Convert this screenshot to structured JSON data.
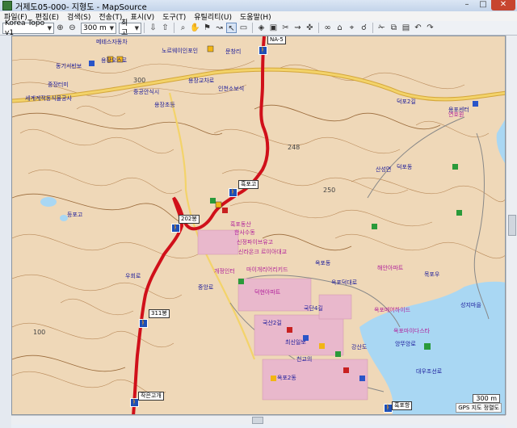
{
  "window": {
    "title": "거제도05-000- 지형도 - MapSource",
    "min": "–",
    "max": "□",
    "close": "✕"
  },
  "menu": [
    "파일(F)",
    "편집(E)",
    "검색(S)",
    "전송(T)",
    "표시(V)",
    "도구(T)",
    "유틸리티(U)",
    "도움말(H)"
  ],
  "toolbar": {
    "map_product": "Korea Topo v1",
    "zoom_level": "300 m",
    "detail": "최고"
  },
  "map": {
    "waypoints": [
      "NA-5",
      "흑포고",
      "202봉",
      "311봉",
      "작은고개",
      "흑포항"
    ],
    "contour_labels": [
      "250",
      "248",
      "100",
      "300"
    ],
    "labels": [
      "메테스자동차",
      "동기서반보",
      "노르웨이인포인",
      "용장오스로",
      "중장터미",
      "세계계적동식물공사",
      "중공안식시",
      "용장교차로",
      "용장초등",
      "문창리",
      "인천소보석",
      "용포센터",
      "덕포2길",
      "덕포동",
      "산성면",
      "등포고",
      "흑포동산",
      "한사수동",
      "신정파이브유고",
      "신라온크 르이아대교",
      "마이개리어리키드",
      "해안아파트",
      "옥포메어하이드",
      "덕현아파트",
      "연호원",
      "옥포마이다스타",
      "성지마을",
      "개정인터",
      "우회로",
      "목포우",
      "옥포동",
      "국산2길",
      "국단4길",
      "옥포덕대로",
      "중앙로",
      "강산도",
      "최신일보",
      "천교의 ",
      "앙뚜앙로",
      "대우조선로",
      "옥포2동"
    ],
    "scale_label": "300 m",
    "status": "GPS 지도 정렬도"
  },
  "colors": {
    "track": "#d0101a",
    "terrain": "#f0dcc0",
    "contour": "#b08050",
    "road": "#e6c24a",
    "water": "#9bd0ee"
  }
}
